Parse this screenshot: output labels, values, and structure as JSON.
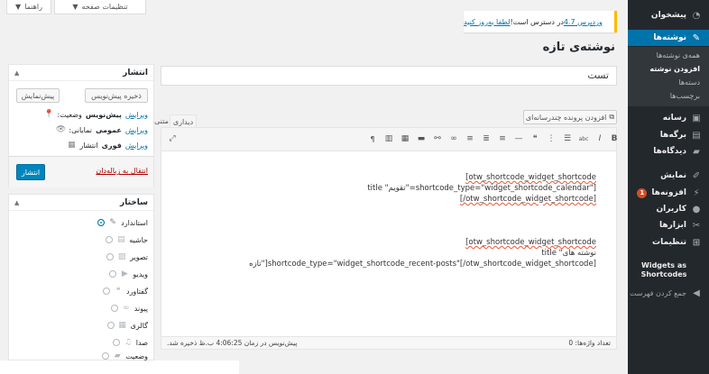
{
  "sidebar": {
    "items": [
      {
        "label": "پیشخوان",
        "icon": "dashboard-icon"
      },
      {
        "label": "نوشته‌ها",
        "icon": "pin-icon"
      },
      {
        "label": "رسانه",
        "icon": "media-icon"
      },
      {
        "label": "برگه‌ها",
        "icon": "pages-icon"
      },
      {
        "label": "دیدگاه‌ها",
        "icon": "comments-icon"
      },
      {
        "label": "نمایش",
        "icon": "appearance-icon"
      },
      {
        "label": "افزونه‌ها",
        "icon": "plugins-icon",
        "badge": "1"
      },
      {
        "label": "کاربران",
        "icon": "users-icon"
      },
      {
        "label": "ابزارها",
        "icon": "tools-icon"
      },
      {
        "label": "تنظیمات",
        "icon": "settings-icon"
      }
    ],
    "submenu": [
      "همه‌ی نوشته‌ها",
      "افزودن نوشته",
      "دسته‌ها",
      "برچسب‌ها"
    ],
    "widgets_line1": "Widgets as",
    "widgets_line2": "Shortcodes",
    "collapse": "جمع کردن فهرست"
  },
  "top": {
    "screen_options": "تنظیمات صفحه",
    "help": "راهنما"
  },
  "notice": {
    "version_link": "وردپرس 4.7",
    "text": " در دسترس است! ",
    "update_link": "لطفا به‌روز کنید"
  },
  "page_title": "نوشته‌ی تازه",
  "post_title": "تست",
  "media_button": "افزودن پرونده چندرسانه‌ای",
  "tabs": {
    "visual": "دیداری",
    "text": "متنی"
  },
  "content": {
    "p1": [
      "[otw_shortcode_widget_shortcode",
      "title \"تقویم\"=shortcode_type=\"widget_shortcode_calendar\"]",
      "[/otw_shortcode_widget_shortcode]"
    ],
    "p2": [
      "[otw_shortcode_widget_shortcode",
      "title \"نوشته های",
      "تازه\"]shortcode_type=\"widget_shortcode_recent-posts\"[/otw_shortcode_widget_shortcode]"
    ]
  },
  "status": {
    "word_count": "تعداد واژه‌ها: 0",
    "draft_saved": "پیش‌نویس در زمان 4:06:25 ب.ظ ذخیره شد."
  },
  "publish": {
    "title": "انتشار",
    "save_draft": "ذخیره پیش‌نویس",
    "preview": "پیش‌نمایش",
    "status_label": "وضعیت:",
    "status_value": "پیش‌نویس",
    "visibility_label": "نمایانی:",
    "visibility_value": "عمومی",
    "publish_label": "انتشار",
    "publish_value": "فوری",
    "edit": "ویرایش",
    "trash": "انتقال به زباله‌دان",
    "publish_button": "انتشار"
  },
  "format": {
    "title": "ساختار",
    "options": [
      "استاندارد",
      "حاشیه",
      "تصویر",
      "ویدیو",
      "گفتاورد",
      "پیوند",
      "گالری",
      "صدا",
      "وضعیت"
    ]
  },
  "colors": {
    "accent": "#0073aa",
    "sidebar": "#23282d",
    "notice": "#ffba00"
  }
}
